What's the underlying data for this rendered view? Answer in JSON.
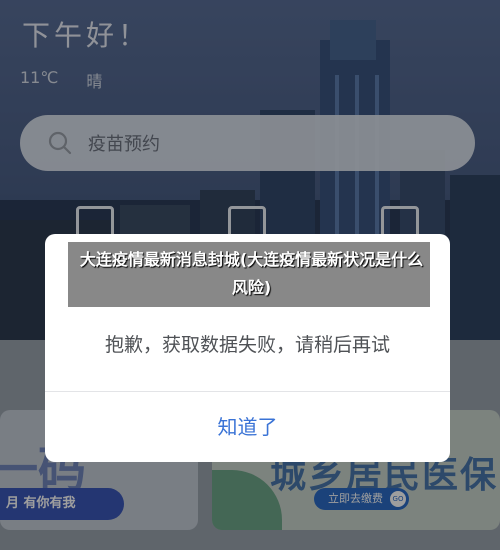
{
  "header": {
    "greeting": "下午好！",
    "temperature": "11℃",
    "condition": "晴"
  },
  "search": {
    "placeholder": "疫苗预约"
  },
  "cards": {
    "left_big": "一码",
    "left_sub": "月 有你有我",
    "right_big": "城乡居民医保",
    "right_button": "立即去缴费",
    "right_go": "GO"
  },
  "article_title": "大连疫情最新消息封城(大连疫情最新状况是什么风险)",
  "dialog": {
    "message": "抱歉，获取数据失败，请稍后再试",
    "confirm": "知道了"
  }
}
